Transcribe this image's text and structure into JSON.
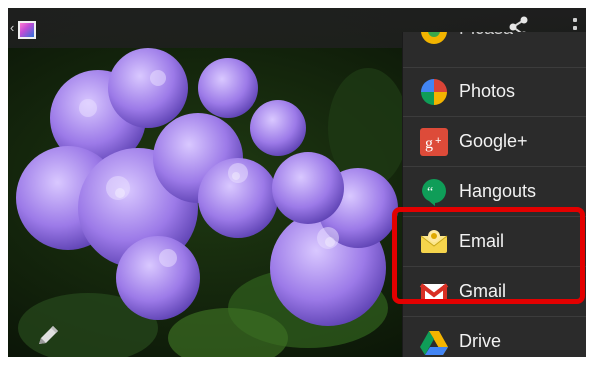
{
  "actionbar": {
    "back_icon": "chevron-left-icon",
    "thumbnail_icon": "gallery-thumbnail-icon",
    "share_icon": "share-icon",
    "overflow_icon": "overflow-menu-icon"
  },
  "share_menu": {
    "items": [
      {
        "label": "Picasa",
        "icon": "picasa-icon"
      },
      {
        "label": "Photos",
        "icon": "photos-pinwheel-icon"
      },
      {
        "label": "Google+",
        "icon": "google-plus-icon"
      },
      {
        "label": "Hangouts",
        "icon": "hangouts-icon"
      },
      {
        "label": "Email",
        "icon": "email-envelope-icon"
      },
      {
        "label": "Gmail",
        "icon": "gmail-icon"
      },
      {
        "label": "Drive",
        "icon": "drive-icon"
      }
    ]
  },
  "colors": {
    "highlight": "#e30000",
    "menu_bg": "#2b2b2b",
    "actionbar_bg": "#202020"
  },
  "edit_icon": "pencil-edit-icon"
}
